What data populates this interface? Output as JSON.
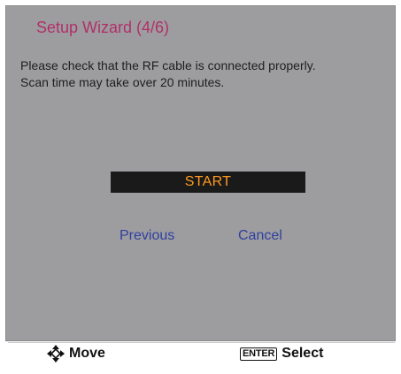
{
  "dialog": {
    "title": "Setup Wizard (4/6)",
    "message_lines": [
      "Please check that the RF cable is connected properly.",
      "Scan time may take over 20 minutes."
    ],
    "start_label": "START",
    "previous_label": "Previous",
    "cancel_label": "Cancel"
  },
  "footer": {
    "move_icon": "four-way-arrow-icon",
    "move_label": "Move",
    "enter_key_label": "ENTER",
    "select_label": "Select"
  },
  "colors": {
    "panel_background": "#9d9d9f",
    "title": "#b0306a",
    "start_button_background": "#1a1a1a",
    "start_button_text": "#ff9a1f",
    "link_text": "#2f3fa0"
  }
}
